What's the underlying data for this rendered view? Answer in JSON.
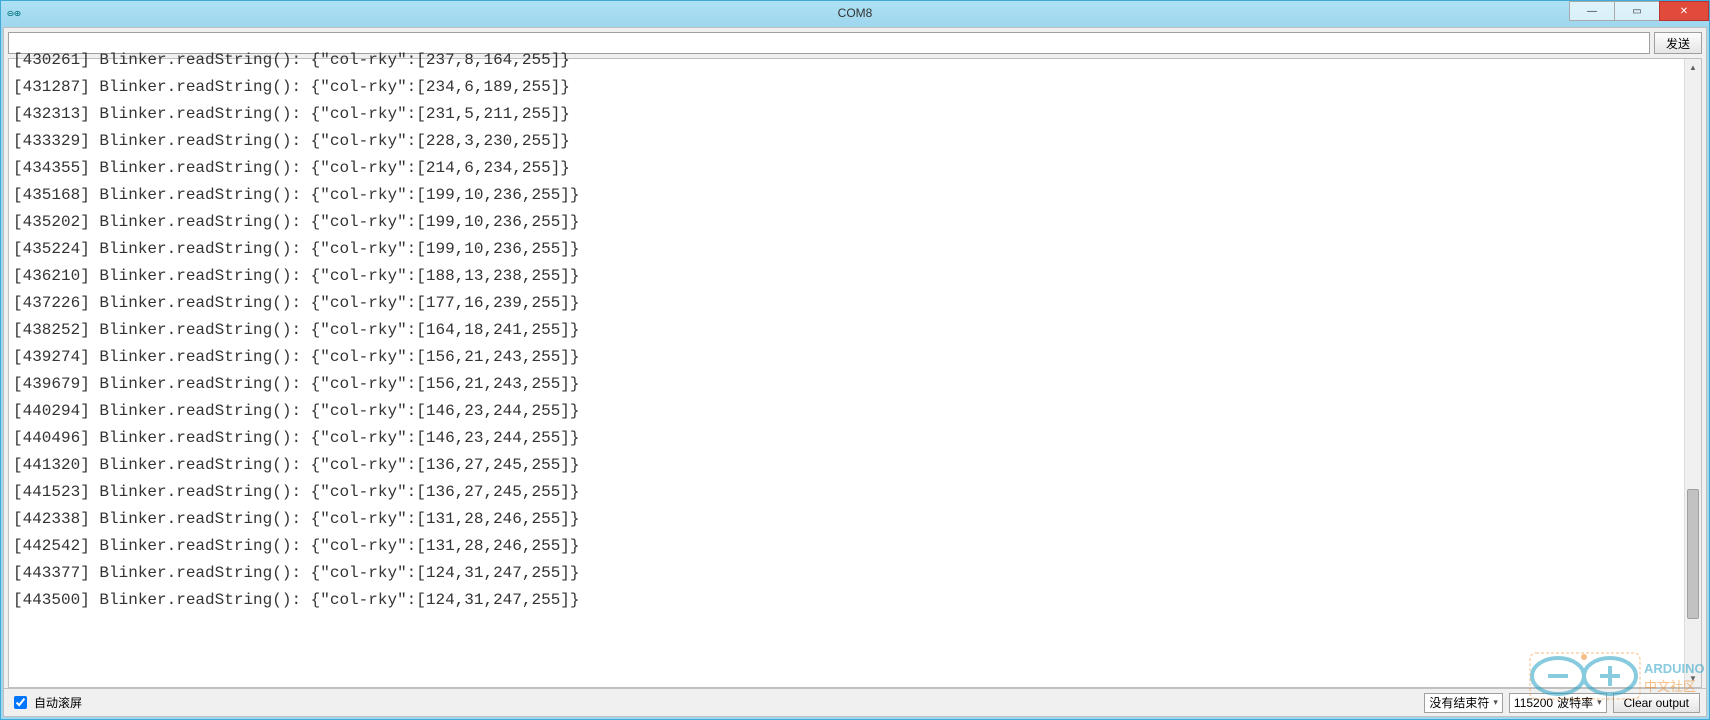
{
  "window": {
    "title": "COM8",
    "minimize_glyph": "—",
    "maximize_glyph": "▭",
    "close_glyph": "✕"
  },
  "toolbar": {
    "send_label": "发送",
    "input_value": ""
  },
  "output_lines": [
    "[430261] Blinker.readString(): {\"col-rky\":[237,8,164,255]}",
    "[431287] Blinker.readString(): {\"col-rky\":[234,6,189,255]}",
    "[432313] Blinker.readString(): {\"col-rky\":[231,5,211,255]}",
    "[433329] Blinker.readString(): {\"col-rky\":[228,3,230,255]}",
    "[434355] Blinker.readString(): {\"col-rky\":[214,6,234,255]}",
    "[435168] Blinker.readString(): {\"col-rky\":[199,10,236,255]}",
    "[435202] Blinker.readString(): {\"col-rky\":[199,10,236,255]}",
    "[435224] Blinker.readString(): {\"col-rky\":[199,10,236,255]}",
    "[436210] Blinker.readString(): {\"col-rky\":[188,13,238,255]}",
    "[437226] Blinker.readString(): {\"col-rky\":[177,16,239,255]}",
    "[438252] Blinker.readString(): {\"col-rky\":[164,18,241,255]}",
    "[439274] Blinker.readString(): {\"col-rky\":[156,21,243,255]}",
    "[439679] Blinker.readString(): {\"col-rky\":[156,21,243,255]}",
    "[440294] Blinker.readString(): {\"col-rky\":[146,23,244,255]}",
    "[440496] Blinker.readString(): {\"col-rky\":[146,23,244,255]}",
    "[441320] Blinker.readString(): {\"col-rky\":[136,27,245,255]}",
    "[441523] Blinker.readString(): {\"col-rky\":[136,27,245,255]}",
    "[442338] Blinker.readString(): {\"col-rky\":[131,28,246,255]}",
    "[442542] Blinker.readString(): {\"col-rky\":[131,28,246,255]}",
    "[443377] Blinker.readString(): {\"col-rky\":[124,31,247,255]}",
    "[443500] Blinker.readString(): {\"col-rky\":[124,31,247,255]}"
  ],
  "footer": {
    "autoscroll_label": "自动滚屏",
    "autoscroll_checked": true,
    "line_ending_selected": "没有结束符",
    "baud_value": "115200",
    "baud_label": "波特率",
    "clear_label": "Clear output"
  },
  "watermark": {
    "text_main": "ARDUINO",
    "text_sub": "中文社区"
  }
}
